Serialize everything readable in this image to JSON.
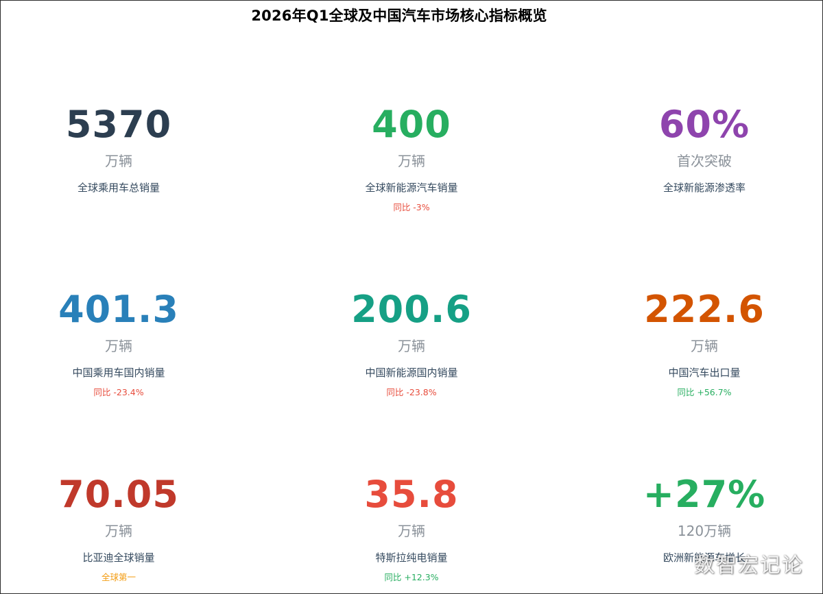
{
  "title": "2026年Q1全球及中国汽车市场核心指标概览",
  "watermark": "数智宏记论",
  "metrics": [
    {
      "value": "5370",
      "unit": "万辆",
      "label": "全球乘用车总销量",
      "sub": "",
      "value_color": "#2c3e50",
      "sub_color": ""
    },
    {
      "value": "400",
      "unit": "万辆",
      "label": "全球新能源汽车销量",
      "sub": "同比 -3%",
      "value_color": "#27ae60",
      "sub_color": "#e74c3c"
    },
    {
      "value": "60%",
      "unit": "首次突破",
      "label": "全球新能源渗透率",
      "sub": "",
      "value_color": "#8e44ad",
      "sub_color": ""
    },
    {
      "value": "401.3",
      "unit": "万辆",
      "label": "中国乘用车国内销量",
      "sub": "同比 -23.4%",
      "value_color": "#2980b9",
      "sub_color": "#e74c3c"
    },
    {
      "value": "200.6",
      "unit": "万辆",
      "label": "中国新能源国内销量",
      "sub": "同比 -23.8%",
      "value_color": "#16a085",
      "sub_color": "#e74c3c"
    },
    {
      "value": "222.6",
      "unit": "万辆",
      "label": "中国汽车出口量",
      "sub": "同比 +56.7%",
      "value_color": "#d35400",
      "sub_color": "#27ae60"
    },
    {
      "value": "70.05",
      "unit": "万辆",
      "label": "比亚迪全球销量",
      "sub": "全球第一",
      "value_color": "#c0392b",
      "sub_color": "#f39c12"
    },
    {
      "value": "35.8",
      "unit": "万辆",
      "label": "特斯拉纯电销量",
      "sub": "同比 +12.3%",
      "value_color": "#e74c3c",
      "sub_color": "#27ae60"
    },
    {
      "value": "+27%",
      "unit": "120万辆",
      "label": "欧洲新能源车增长",
      "sub": "",
      "value_color": "#27ae60",
      "sub_color": ""
    }
  ]
}
